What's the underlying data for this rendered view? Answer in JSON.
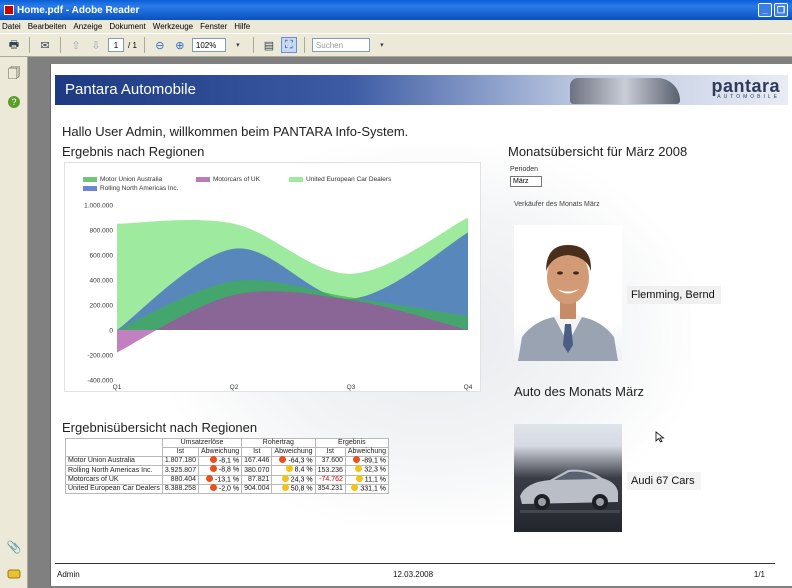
{
  "window": {
    "title": "Home.pdf - Adobe Reader"
  },
  "menu": [
    "Datei",
    "Bearbeiten",
    "Anzeige",
    "Dokument",
    "Werkzeuge",
    "Fenster",
    "Hilfe"
  ],
  "toolbar": {
    "page_current": "1",
    "page_total": "/ 1",
    "zoom": "102%",
    "search_placeholder": "Suchen"
  },
  "header": {
    "title": "Pantara Automobile",
    "logo_name": "pantara",
    "logo_sub": "AUTOMOBILE"
  },
  "welcome": "Hallo User Admin, willkommen beim PANTARA Info-System.",
  "region_title": "Ergebnis nach Regionen",
  "month": {
    "title": "Monatsübersicht für März 2008",
    "period_label": "Perioden",
    "period_value": "März",
    "seller_label": "Verkäufer des Monats März",
    "seller_name": "Flemming, Bernd",
    "auto_title": "Auto des Monats März",
    "car_name": "Audi 67 Cars"
  },
  "chart_data": {
    "type": "area",
    "categories": [
      "Q1",
      "Q2",
      "Q3",
      "Q4"
    ],
    "ylim": [
      -400000,
      1000000
    ],
    "yticks": [
      "1.000.000",
      "800.000",
      "600.000",
      "400.000",
      "200.000",
      "0",
      "-200.000",
      "-400.000"
    ],
    "ytick_values": [
      1000000,
      800000,
      600000,
      400000,
      200000,
      0,
      -200000,
      -400000
    ],
    "series": [
      {
        "name": "Motor Union Australia",
        "color": "#3cb44b",
        "values": [
          0,
          390000,
          260000,
          110000
        ]
      },
      {
        "name": "Motorcars of UK",
        "color": "#a64ca6",
        "values": [
          -180000,
          280000,
          240000,
          0
        ]
      },
      {
        "name": "United European Car Dealers",
        "color": "#7ee37e",
        "values": [
          850000,
          850000,
          450000,
          900000
        ]
      },
      {
        "name": "Rolling North Americas Inc.",
        "color": "#3a5ec8",
        "values": [
          0,
          650000,
          250000,
          780000
        ]
      }
    ]
  },
  "table": {
    "title": "Ergebnisübersicht nach Regionen",
    "groups": [
      "Umsatzerlöse",
      "Rohertrag",
      "Ergebnis"
    ],
    "subheaders": [
      "Ist",
      "Abweichung",
      "Ist",
      "Abweichung",
      "Ist",
      "Abweichung"
    ],
    "rows": [
      {
        "name": "Motor Union Australia",
        "cells": [
          "1.807.180",
          "-8,1 %",
          "167.446",
          "-64,3 %",
          "37.600",
          "-89,1 %"
        ],
        "dots": [
          "#e8501c",
          "#e8501c",
          "#e8501c"
        ]
      },
      {
        "name": "Rolling North Americas Inc.",
        "cells": [
          "3.925.807",
          "-8,8 %",
          "380.070",
          "8,4 %",
          "153.236",
          "32,3 %"
        ],
        "dots": [
          "#e8501c",
          "#f0c419",
          "#f0c419"
        ]
      },
      {
        "name": "Motorcars of UK",
        "cells": [
          "880.404",
          "-13,1 %",
          "87.821",
          "24,3 %",
          "-74.762",
          "11,1 %"
        ],
        "dots": [
          "#e8501c",
          "#f0c419",
          "#f0c419"
        ]
      },
      {
        "name": "United European Car Dealers",
        "cells": [
          "8.388.258",
          "-2,0 %",
          "904.004",
          "50,8 %",
          "354.231",
          "331,1 %"
        ],
        "dots": [
          "#e8501c",
          "#f0c419",
          "#f0c419"
        ]
      }
    ]
  },
  "footer": {
    "user": "Admin",
    "date": "12.03.2008",
    "page": "1/1"
  }
}
